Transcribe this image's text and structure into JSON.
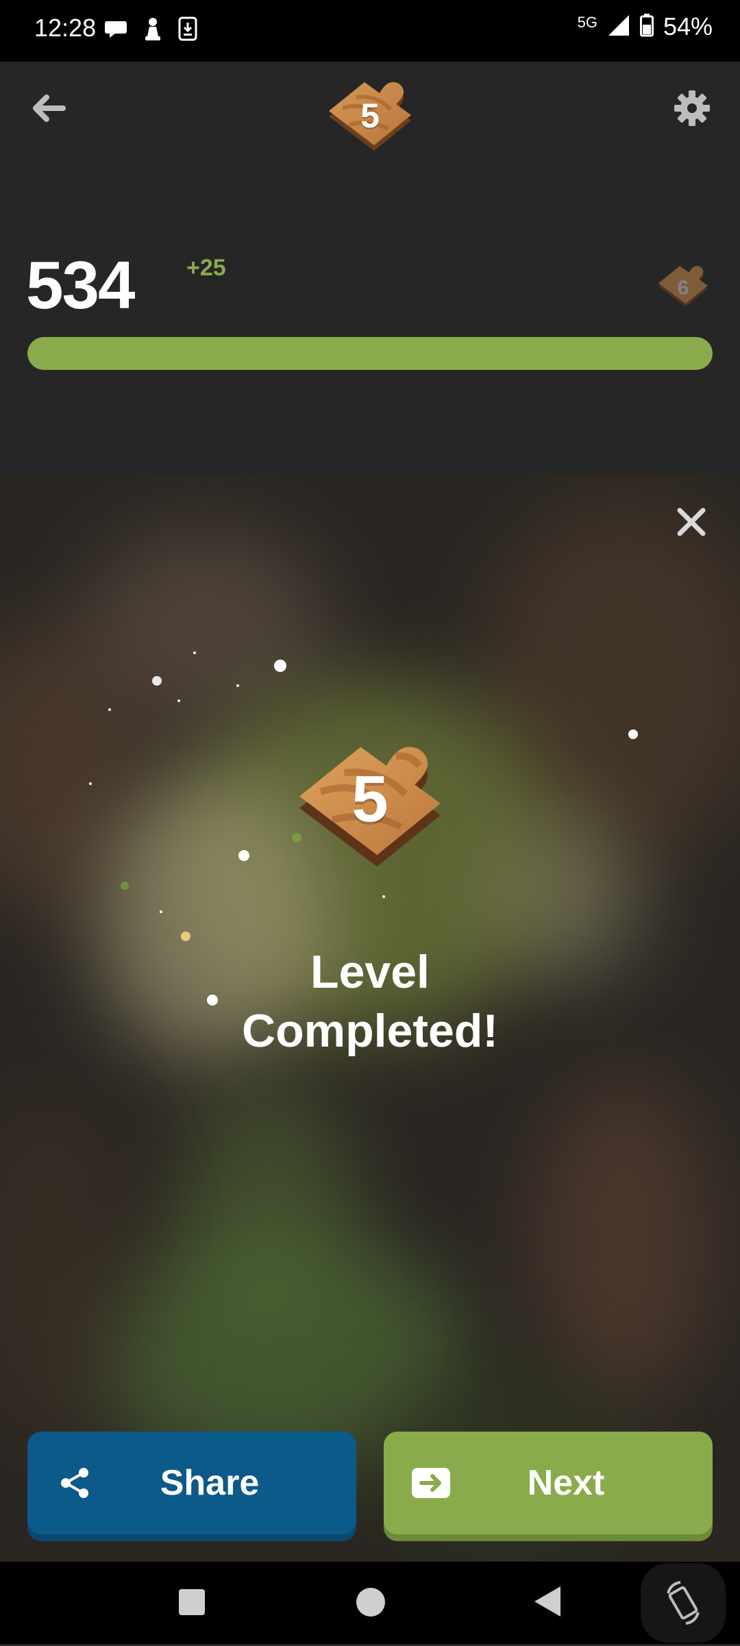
{
  "status_bar": {
    "time": "12:28",
    "network": "5G",
    "battery": "54%",
    "icons": [
      "chat-bubble-icon",
      "chess-pawn-icon",
      "download-icon",
      "signal-icon",
      "battery-icon"
    ]
  },
  "header": {
    "back_icon": "arrow-left-icon",
    "settings_icon": "gear-icon",
    "current_level": "5",
    "score": "534",
    "score_bonus": "+25",
    "next_level": "6",
    "progress_fraction": 1.0
  },
  "overlay": {
    "close_icon": "close-icon",
    "level_number": "5",
    "title_line1": "Level",
    "title_line2": "Completed!"
  },
  "actions": {
    "share_label": "Share",
    "share_icon": "share-icon",
    "next_label": "Next",
    "next_icon": "arrow-right-box-icon"
  },
  "colors": {
    "accent_green": "#8aab4b",
    "share_blue": "#0c5a8a",
    "background": "#262626"
  },
  "nav_bar": {
    "icons": [
      "recents-square-icon",
      "home-circle-icon",
      "back-triangle-icon",
      "rotate-icon"
    ]
  }
}
